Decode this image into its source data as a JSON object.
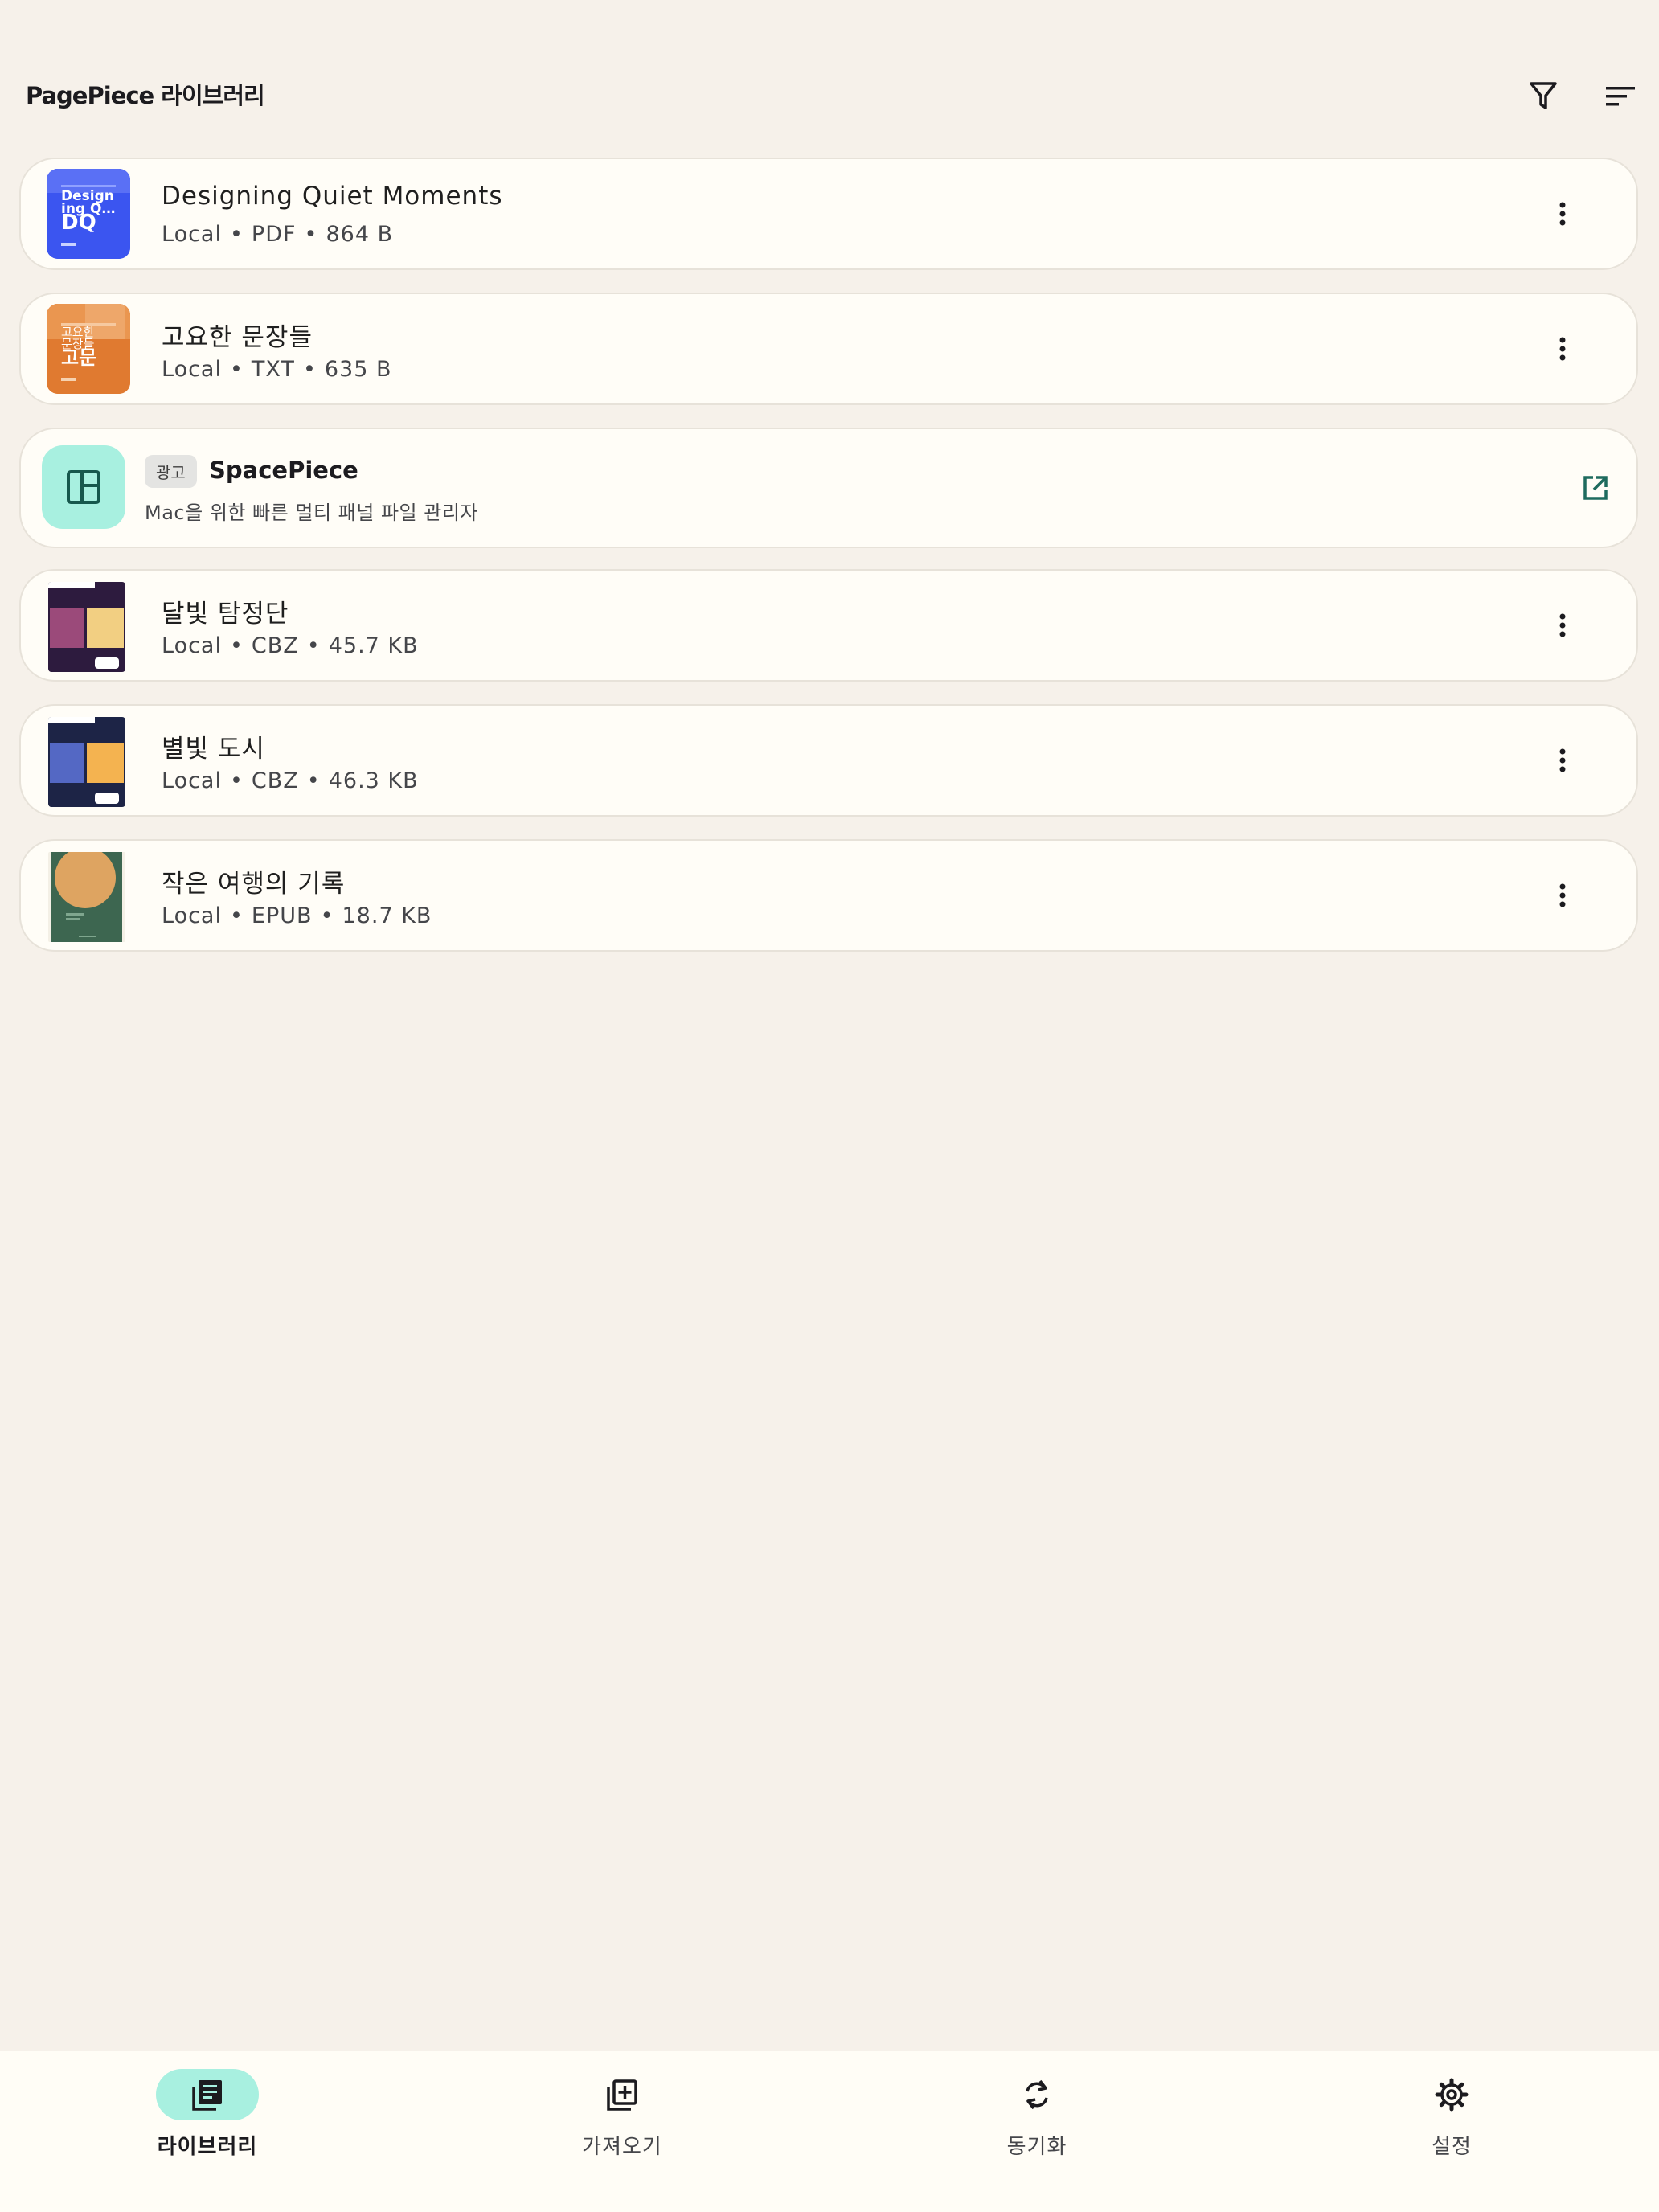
{
  "header": {
    "title": "PagePiece 라이브러리",
    "filter_icon": "filter-icon",
    "sort_icon": "sort-icon"
  },
  "books": [
    {
      "title": "Designing Quiet Moments",
      "source": "Local",
      "format": "PDF",
      "size": "864 B",
      "cover": {
        "style": "blue",
        "line1": "Design",
        "line2": "ing Q…",
        "initials": "DQ"
      }
    },
    {
      "title": "고요한 문장들",
      "source": "Local",
      "format": "TXT",
      "size": "635 B",
      "cover": {
        "style": "orange",
        "line1": "고요한",
        "line2": "문장들",
        "initials": "고문"
      }
    },
    {
      "title": "달빛 탐정단",
      "source": "Local",
      "format": "CBZ",
      "size": "45.7 KB",
      "cover": {
        "style": "comic-purple"
      }
    },
    {
      "title": "별빛 도시",
      "source": "Local",
      "format": "CBZ",
      "size": "46.3 KB",
      "cover": {
        "style": "comic-navy"
      }
    },
    {
      "title": "작은 여행의 기록",
      "source": "Local",
      "format": "EPUB",
      "size": "18.7 KB",
      "cover": {
        "style": "green-sun"
      }
    }
  ],
  "ad": {
    "badge": "광고",
    "title": "SpacePiece",
    "description": "Mac을 위한 빠른 멀티 패널 파일 관리자",
    "icon": "panel-layout-icon",
    "link_icon": "open-external-icon"
  },
  "nav": [
    {
      "label": "라이브러리",
      "icon": "library-icon",
      "active": true
    },
    {
      "label": "가져오기",
      "icon": "import-icon",
      "active": false
    },
    {
      "label": "동기화",
      "icon": "sync-icon",
      "active": false
    },
    {
      "label": "설정",
      "icon": "settings-icon",
      "active": false
    }
  ],
  "colors": {
    "background": "#f6f1ea",
    "card": "#fffdf7",
    "accent": "#a8f0e0",
    "ad_link": "#1e6b5e"
  }
}
